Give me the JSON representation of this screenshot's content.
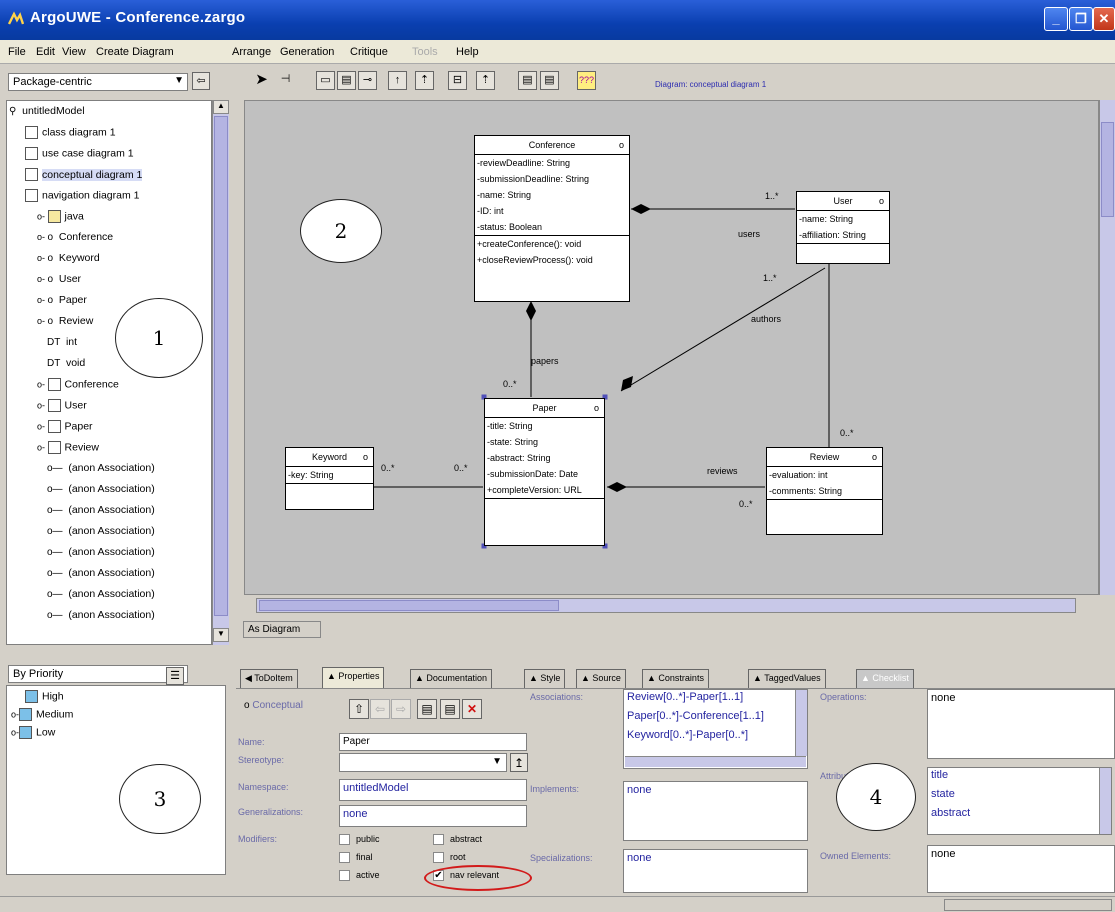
{
  "window": {
    "title": "ArgoUWE - Conference.zargo"
  },
  "menu": [
    "File",
    "Edit",
    "View",
    "Create Diagram",
    "Arrange",
    "Generation",
    "Critique",
    "Tools",
    "Help"
  ],
  "explorer": {
    "perspective": "Package-centric",
    "tree": [
      {
        "label": "untitledModel",
        "icon": "model-icon"
      },
      {
        "label": "class diagram 1",
        "icon": "diagram-icon"
      },
      {
        "label": "use case diagram 1",
        "icon": "diagram-icon"
      },
      {
        "label": "conceptual diagram 1",
        "icon": "diagram-icon",
        "selected": true
      },
      {
        "label": "navigation diagram 1",
        "icon": "diagram-icon"
      },
      {
        "label": "java",
        "icon": "folder-icon"
      },
      {
        "label": "Conference",
        "icon": "class-icon"
      },
      {
        "label": "Keyword",
        "icon": "class-icon"
      },
      {
        "label": "User",
        "icon": "class-icon"
      },
      {
        "label": "Paper",
        "icon": "class-icon"
      },
      {
        "label": "Review",
        "icon": "class-icon"
      },
      {
        "label": "int",
        "icon": "datatype-icon"
      },
      {
        "label": "void",
        "icon": "datatype-icon"
      },
      {
        "label": "Conference",
        "icon": "box-icon"
      },
      {
        "label": "User",
        "icon": "box-icon"
      },
      {
        "label": "Paper",
        "icon": "box-icon"
      },
      {
        "label": "Review",
        "icon": "box-icon"
      },
      {
        "label": "(anon Association)",
        "icon": "association-icon"
      },
      {
        "label": "(anon Association)",
        "icon": "association-icon"
      },
      {
        "label": "(anon Association)",
        "icon": "association-icon"
      },
      {
        "label": "(anon Association)",
        "icon": "association-icon"
      },
      {
        "label": "(anon Association)",
        "icon": "association-icon"
      },
      {
        "label": "(anon Association)",
        "icon": "association-icon"
      },
      {
        "label": "(anon Association)",
        "icon": "association-icon"
      },
      {
        "label": "(anon Association)",
        "icon": "association-icon"
      }
    ]
  },
  "diagram": {
    "label": "Diagram: conceptual diagram 1",
    "tab": "As Diagram",
    "classes": {
      "conference": {
        "name": "Conference",
        "attrs": [
          "-reviewDeadline: String",
          "-submissionDeadline: String",
          "-name: String",
          "-ID: int",
          "-status: Boolean"
        ],
        "ops": [
          "+createConference(): void",
          "+closeReviewProcess(): void"
        ]
      },
      "user": {
        "name": "User",
        "attrs": [
          "-name: String",
          "-affiliation: String"
        ]
      },
      "paper": {
        "name": "Paper",
        "attrs": [
          "-title: String",
          "-state: String",
          "-abstract: String",
          "-submissionDate: Date",
          "+completeVersion: URL"
        ]
      },
      "keyword": {
        "name": "Keyword",
        "attrs": [
          "-key: String"
        ]
      },
      "review": {
        "name": "Review",
        "attrs": [
          "-evaluation: int",
          "-comments: String"
        ]
      }
    },
    "labels": {
      "users": "users",
      "authors": "authors",
      "papers": "papers",
      "reviews": "reviews",
      "m1": "1..*",
      "m2": "1..*",
      "m3": "0..*",
      "m4": "0..*",
      "m5": "0..*",
      "m6": "0..*",
      "m7": "0..*"
    },
    "callouts": [
      "1",
      "2",
      "3",
      "4"
    ]
  },
  "todo": {
    "sort": "By Priority",
    "items": [
      "High",
      "Medium",
      "Low"
    ]
  },
  "tabs": [
    "ToDoItem",
    "Properties",
    "Documentation",
    "Style",
    "Source",
    "Constraints",
    "TaggedValues",
    "Checklist"
  ],
  "props": {
    "kind": "Conceptual",
    "name_label": "Name:",
    "name": "Paper",
    "stereotype_label": "Stereotype:",
    "namespace_label": "Namespace:",
    "namespace": "untitledModel",
    "generalizations_label": "Generalizations:",
    "generalizations": "none",
    "modifiers_label": "Modifiers:",
    "modifiers": {
      "public": "public",
      "final": "final",
      "active": "active",
      "abstract": "abstract",
      "root": "root",
      "nav": "nav relevant"
    },
    "associations_label": "Associations:",
    "associations": [
      "Review[0..*]-Paper[1..1]",
      "Paper[0..*]-Conference[1..1]",
      "Keyword[0..*]-Paper[0..*]"
    ],
    "implements_label": "Implements:",
    "implements": "none",
    "specializations_label": "Specializations:",
    "specializations": "none",
    "operations_label": "Operations:",
    "operations": "none",
    "attributes_label": "Attributes:",
    "attributes": [
      "title",
      "state",
      "abstract"
    ],
    "owned_label": "Owned Elements:",
    "owned": "none"
  }
}
